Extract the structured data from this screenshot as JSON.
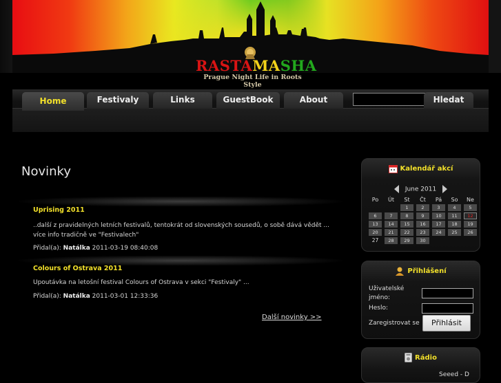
{
  "brand": {
    "name_part1": "RASTA",
    "name_part2": "MA",
    "name_part3": "SHA",
    "tagline": "Prague Night Life in Roots Style",
    "logo_icon": "lion-icon",
    "colors": {
      "red": "#d81414",
      "yellow": "#f2d21a",
      "green": "#22a81d"
    }
  },
  "nav": {
    "tabs": [
      {
        "label": "Home",
        "active": true
      },
      {
        "label": "Festivaly",
        "active": false
      },
      {
        "label": "Links",
        "active": false
      },
      {
        "label": "GuestBook",
        "active": false
      },
      {
        "label": "About",
        "active": false
      }
    ],
    "search": {
      "value": "",
      "placeholder": ""
    },
    "search_button": "Hledat"
  },
  "main": {
    "title": "Novinky",
    "news": [
      {
        "title": "Uprising 2011",
        "text": "..další z pravidelných letních festivalů, tentokrát od slovenských sousedů, o sobě dává vědět ... více info tradičně ve \"Festivalech\"",
        "added_label": "Přidal(a):",
        "author": "Natálka",
        "date": "2011-03-19 08:40:08"
      },
      {
        "title": "Colours of Ostrava 2011",
        "text": "Upoutávka na letošní festival Colours of Ostrava v sekci \"Festivaly\" ...",
        "added_label": "Přidal(a):",
        "author": "Natálka",
        "date": "2011-03-01 12:33:36"
      }
    ],
    "more_link": "Další novinky >>"
  },
  "sidebar": {
    "calendar": {
      "title": "Kalendář akcí",
      "icon": "calendar-icon",
      "month": "June 2011",
      "weekdays": [
        "Po",
        "Út",
        "St",
        "Čt",
        "Pá",
        "So",
        "Ne"
      ],
      "rows": [
        [
          "",
          "",
          "1",
          "2",
          "3",
          "4",
          "5"
        ],
        [
          "6",
          "7",
          "8",
          "9",
          "10",
          "11",
          "12"
        ],
        [
          "13",
          "14",
          "15",
          "16",
          "17",
          "18",
          "19"
        ],
        [
          "20",
          "21",
          "22",
          "23",
          "24",
          "25",
          "26"
        ],
        [
          "27",
          "28",
          "29",
          "30",
          "",
          "",
          ""
        ]
      ],
      "today": "12",
      "today_color": "#e22222"
    },
    "login": {
      "title": "Přihlášení",
      "icon": "user-icon",
      "username_label_1": "Uživatelské",
      "username_label_2": "jméno:",
      "username_value": "",
      "password_label": "Heslo:",
      "password_value": "",
      "register_link": "Zaregistrovat se",
      "login_button": "Přihlásit"
    },
    "radio": {
      "title": "Rádio",
      "icon": "radio-icon",
      "station": "Seeed - D"
    }
  }
}
